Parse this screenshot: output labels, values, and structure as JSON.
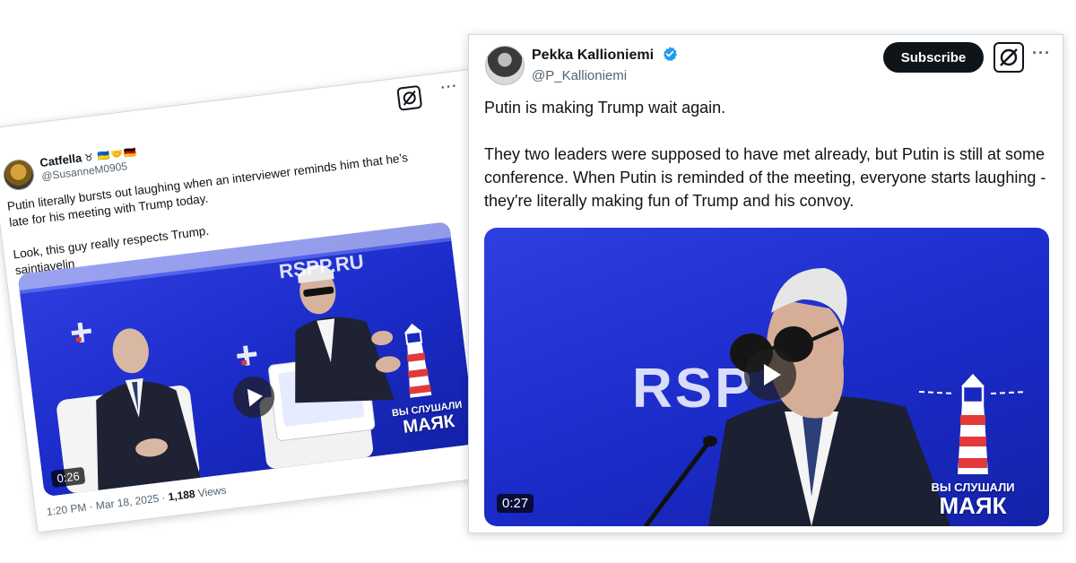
{
  "left_tweet": {
    "display_name": "Catfella",
    "name_emojis": "♉ 🇺🇦🤝🇩🇪",
    "handle": "@SusanneM0905",
    "text_line1": "Putin literally bursts out laughing when an interviewer reminds him that he’s late for his meeting with Trump today.",
    "text_line2": "Look, this guy really respects Trump.",
    "text_line3": "saintjavelin",
    "more_icon": "···",
    "video": {
      "duration": "0:26",
      "watermark_small": "ВЫ СЛУШАЛИ",
      "watermark_big": "МАЯК",
      "stage_text": "RSPP.RU"
    },
    "timestamp": "1:20 PM · Mar 18, 2025 · ",
    "views_count": "1,188",
    "views_label": " Views"
  },
  "right_tweet": {
    "display_name": "Pekka Kallioniemi",
    "handle": "@P_Kallioniemi",
    "subscribe_label": "Subscribe",
    "more_icon": "···",
    "text_line1": "Putin is making Trump wait again.",
    "text_line2": "They two leaders were supposed to have met already, but Putin is still at some conference. When Putin is reminded of the meeting, everyone starts laughing - they're literally making fun of Trump and his convoy.",
    "video": {
      "duration": "0:27",
      "watermark_small": "ВЫ СЛУШАЛИ",
      "watermark_big": "МАЯК",
      "stage_text": "RSP"
    }
  },
  "colors": {
    "verified_blue": "#1d9bf0",
    "stage_blue": "#1f30d0",
    "lighthouse_red": "#e23a3a"
  },
  "icons": [
    "grok-icon",
    "verified-badge-icon",
    "play-icon",
    "lighthouse-icon"
  ]
}
